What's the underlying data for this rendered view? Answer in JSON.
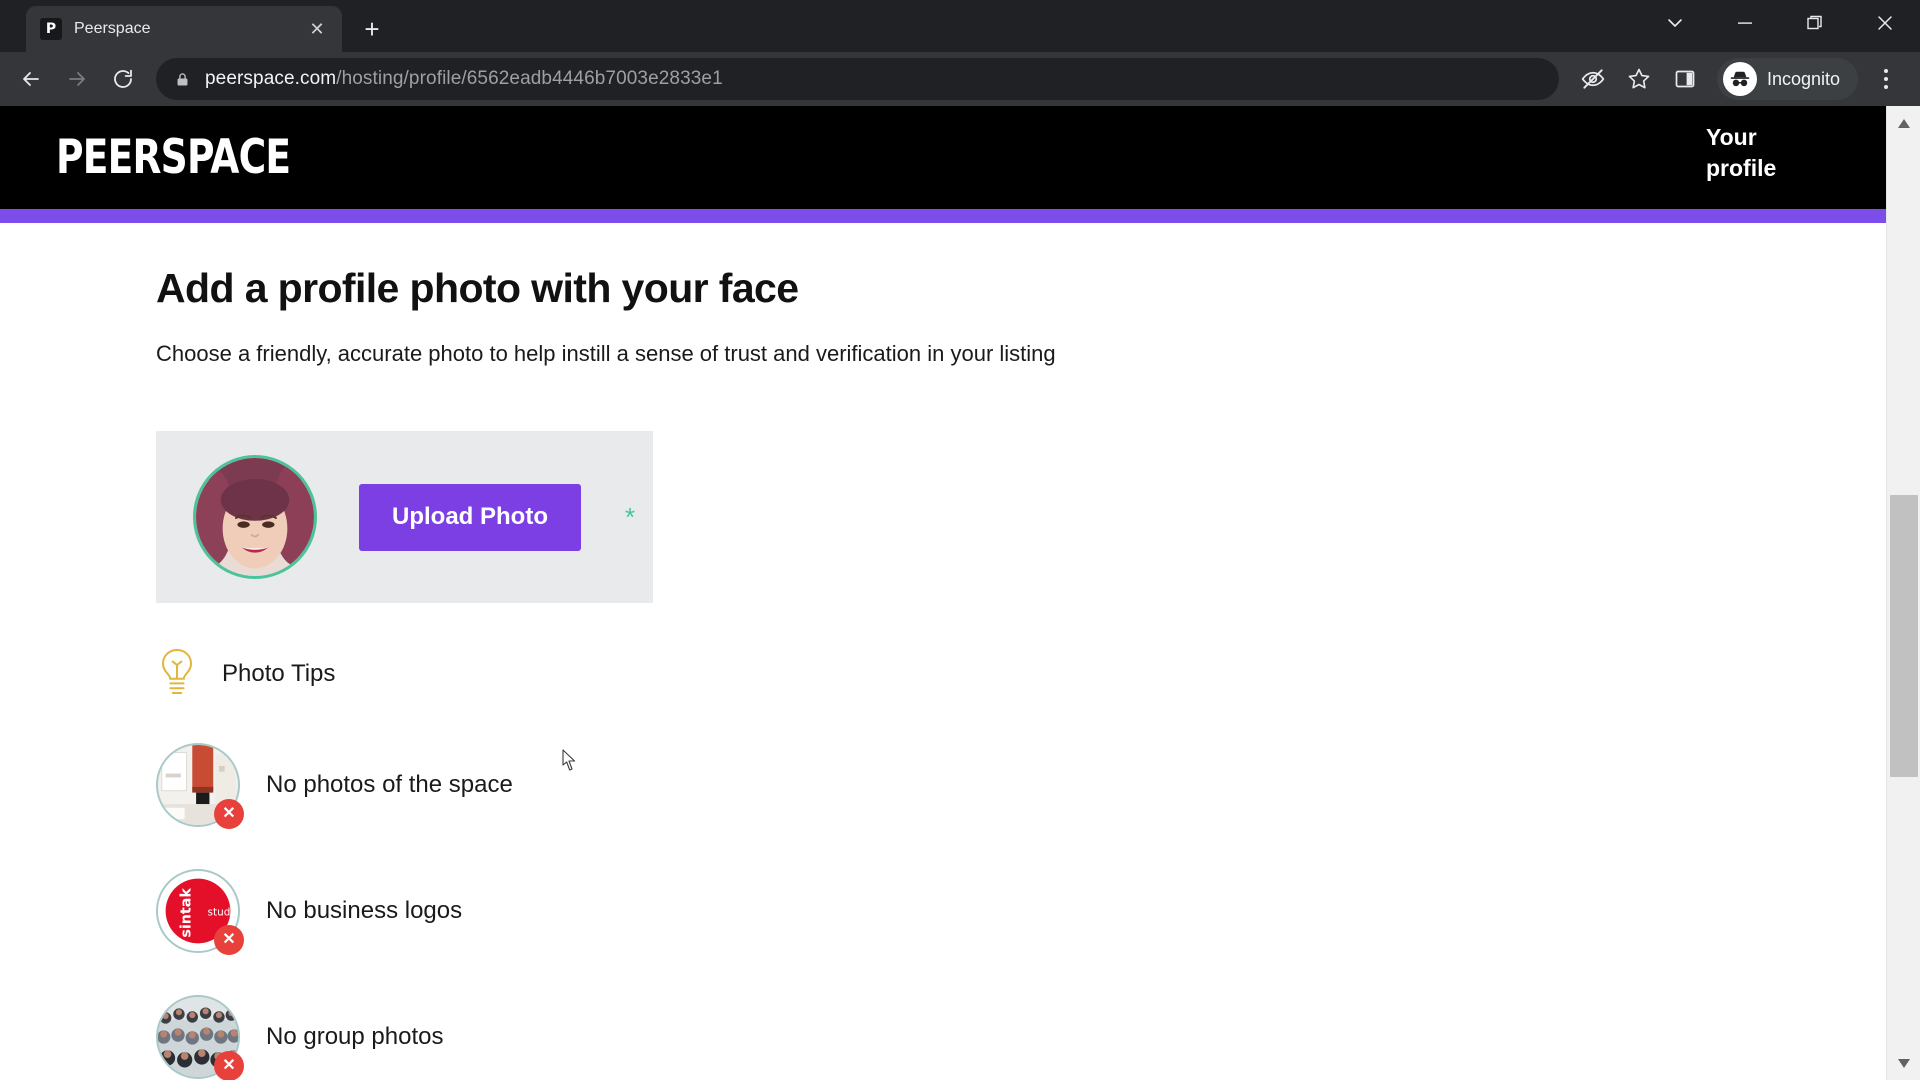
{
  "browser": {
    "tab": {
      "title": "Peerspace",
      "favicon_letter": "P",
      "favicon_name": "peerspace-favicon",
      "close_label": "✕"
    },
    "new_tab_label": "+",
    "window_controls": [
      {
        "name": "tab-search-button",
        "label": "⌄"
      },
      {
        "name": "minimize-button",
        "label": "—"
      },
      {
        "name": "maximize-button",
        "label": "❐"
      },
      {
        "name": "close-window-button",
        "label": "✕"
      }
    ],
    "nav": {
      "back_label": "←",
      "forward_label": "→",
      "reload_label": "↻"
    },
    "omnibox": {
      "lock_icon": "lock-icon",
      "url_domain": "peerspace.com",
      "url_path": "/hosting/profile/6562eadb4446b7003e2833e1",
      "url_full": "peerspace.com/hosting/profile/6562eadb4446b7003e2833e1"
    },
    "toolbar_icons": [
      {
        "name": "eye-slash-icon",
        "title": "Tracking protection"
      },
      {
        "name": "bookmark-star-icon",
        "title": "Bookmark this tab"
      },
      {
        "name": "side-panel-icon",
        "title": "Side panel"
      }
    ],
    "profile": {
      "label": "Incognito",
      "avatar_name": "incognito-avatar-icon"
    },
    "menu_label": "⋮"
  },
  "site": {
    "logo_text": "PEERSPACE",
    "nav_link": "Your profile",
    "progress_percent": 100,
    "accent_purple": "#7b3fe4",
    "accent_green": "#4cc49a",
    "header_bg": "#000000"
  },
  "main": {
    "heading": "Add a profile photo with your face",
    "subheading": "Choose a friendly, accurate photo to help instill a sense of trust and verification in your listing",
    "upload": {
      "avatar_name": "profile-avatar-preview",
      "button_label": "Upload Photo",
      "required_marker": "*"
    },
    "tips": {
      "icon": "lightbulb-icon",
      "title": "Photo Tips",
      "items": [
        {
          "label": "No photos of the space",
          "thumb": "room-interior-thumbnail",
          "badge": "✕"
        },
        {
          "label": "No business logos",
          "thumb": "business-logo-thumbnail",
          "badge": "✕",
          "logo_text_1": "sintak",
          "logo_text_2": "studio"
        },
        {
          "label": "No group photos",
          "thumb": "group-photo-thumbnail",
          "badge": "✕"
        }
      ]
    }
  },
  "scrollbar": {
    "up_arrow": "▲",
    "down_arrow": "▼"
  }
}
